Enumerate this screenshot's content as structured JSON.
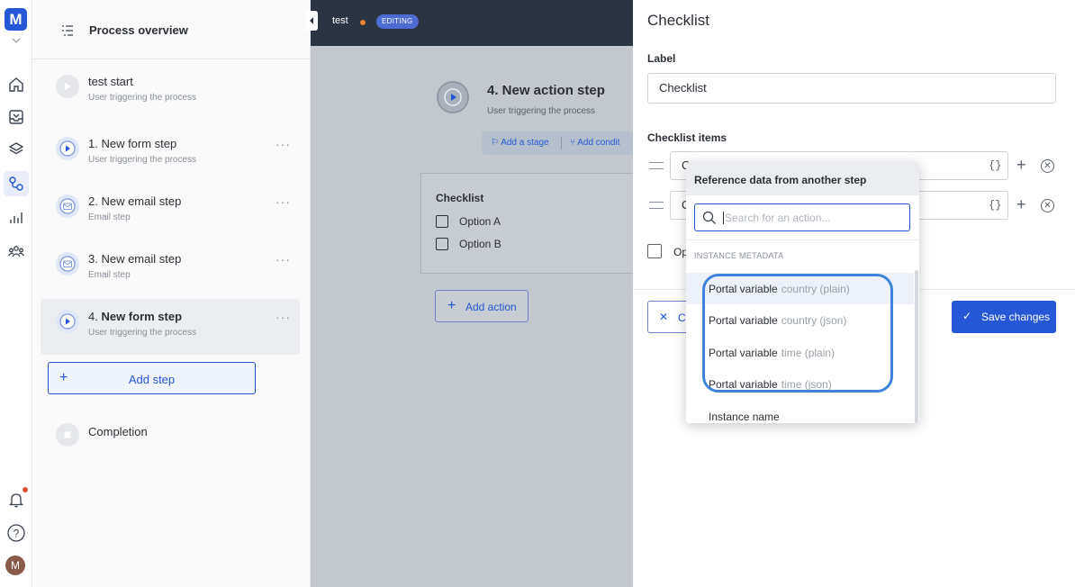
{
  "rail": {
    "logo": "M",
    "avatar": "M"
  },
  "sidebar": {
    "overview_label": "Process overview",
    "steps": [
      {
        "title": "test start",
        "sub": "User triggering the process"
      },
      {
        "title": "1. New form step",
        "sub": "User triggering the process",
        "more": "···"
      },
      {
        "title": "2. New email step",
        "sub": "Email step",
        "more": "···"
      },
      {
        "title": "3. New email step",
        "sub": "Email step",
        "more": "···"
      },
      {
        "title": "4.",
        "title_strong": "New form step",
        "sub": "User triggering the process",
        "more": "···"
      }
    ],
    "add_step_label": "Add step",
    "completion_label": "Completion"
  },
  "canvas": {
    "process_name": "test",
    "status_badge": "EDITING",
    "node_title": "4. New action step",
    "node_sub": "User triggering the process",
    "add_stage": "Add a stage",
    "add_condition": "Add condit",
    "card_title": "Checklist",
    "card_options": [
      "Option A",
      "Option B"
    ],
    "add_action_label": "Add action"
  },
  "panel": {
    "title": "Checklist",
    "label_heading": "Label",
    "label_value": "Checklist",
    "items_heading": "Checklist items",
    "item1_value": "O",
    "item2_value": "O",
    "braces": "{}",
    "option_text": "Op",
    "cancel_label": "C",
    "save_label": "Save changes"
  },
  "dropdown": {
    "heading": "Reference data from another step",
    "search_placeholder": "Search for an action...",
    "section_label": "INSTANCE METADATA",
    "rows": [
      {
        "name": "Portal variable",
        "detail": "country (plain)"
      },
      {
        "name": "Portal variable",
        "detail": "country (json)"
      },
      {
        "name": "Portal variable",
        "detail": "time (plain)"
      },
      {
        "name": "Portal variable",
        "detail": "time (json)"
      },
      {
        "name": "Instance name",
        "detail": ""
      }
    ]
  },
  "colors": {
    "accent": "#2557d6",
    "topbar": "#2b3441",
    "canvas": "#c3c8ce",
    "annotation": "#3d83d9",
    "status_dot": "#e5873b"
  }
}
